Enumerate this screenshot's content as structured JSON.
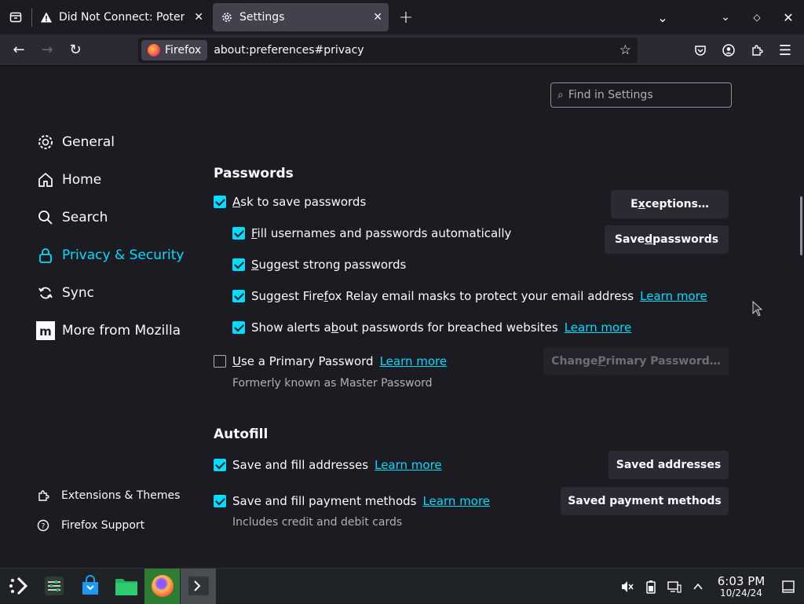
{
  "tabs": [
    {
      "title": "Did Not Connect: Potential Security Issue",
      "icon": "warning-icon",
      "active": false
    },
    {
      "title": "Settings",
      "icon": "gear-icon",
      "active": true
    }
  ],
  "navbar": {
    "identity_label": "Firefox",
    "url": "about:preferences#privacy"
  },
  "search": {
    "placeholder": "Find in Settings"
  },
  "sidebar": {
    "items": [
      {
        "label": "General",
        "icon": "gear-icon"
      },
      {
        "label": "Home",
        "icon": "home-icon"
      },
      {
        "label": "Search",
        "icon": "search-icon"
      },
      {
        "label": "Privacy & Security",
        "icon": "lock-icon",
        "selected": true
      },
      {
        "label": "Sync",
        "icon": "sync-icon"
      },
      {
        "label": "More from Mozilla",
        "icon": "mozilla-icon"
      }
    ],
    "footer": [
      {
        "label": "Extensions & Themes",
        "icon": "puzzle-icon"
      },
      {
        "label": "Firefox Support",
        "icon": "help-icon"
      }
    ]
  },
  "passwords": {
    "title": "Passwords",
    "ask_save": {
      "pre": "",
      "u": "A",
      "post": "sk to save passwords",
      "checked": true
    },
    "fill": {
      "pre": "",
      "u": "F",
      "post": "ill usernames and passwords automatically",
      "checked": true
    },
    "suggest_strong": {
      "pre": "",
      "u": "S",
      "post": "uggest strong passwords",
      "checked": true
    },
    "relay": {
      "pre": "Suggest Fire",
      "u": "f",
      "post": "ox Relay email masks to protect your email address",
      "checked": true,
      "link": "Learn more"
    },
    "breach": {
      "pre": "Show alerts a",
      "u": "b",
      "post": "out passwords for breached websites",
      "checked": true,
      "link": "Learn more"
    },
    "primary": {
      "pre": "",
      "u": "U",
      "post": "se a Primary Password",
      "checked": false,
      "link": "Learn more"
    },
    "primary_note": "Formerly known as Master Password",
    "exceptions_btn": {
      "pre": "E",
      "u": "x",
      "post": "ceptions…"
    },
    "saved_btn": {
      "pre": "Save",
      "u": "d",
      "post": " passwords"
    },
    "change_primary_btn": {
      "pre": "Change ",
      "u": "P",
      "post": "rimary Password…"
    }
  },
  "autofill": {
    "title": "Autofill",
    "addresses": {
      "label": "Save and fill addresses",
      "checked": true,
      "link": "Learn more"
    },
    "payments": {
      "label": "Save and fill payment methods",
      "checked": true,
      "link": "Learn more"
    },
    "payments_note": "Includes credit and debit cards",
    "saved_addresses_btn": "Saved addresses",
    "saved_payments_btn": "Saved payment methods"
  },
  "taskbar": {
    "time": "6:03 PM",
    "date": "10/24/24"
  },
  "colors": {
    "accent": "#00ddff",
    "background": "#1c1b22",
    "toolbar": "#2b2a33",
    "taskbar": "#202326"
  }
}
